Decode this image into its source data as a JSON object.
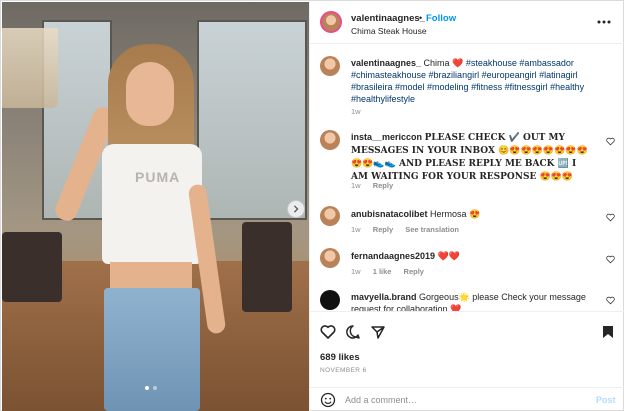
{
  "post": {
    "username": "valentinaagnes_",
    "separator": "•",
    "follow_label": "Follow",
    "location": "Chima Steak House",
    "image_shirt_text": "PUMA"
  },
  "caption": {
    "username": "valentinaagnes_",
    "text_before_emoji": "Chima",
    "emoji": "❤️",
    "hashtags": "#steakhouse #ambassador #chimasteakhouse #braziliangirl #europeangirl #latinagirl #brasileira #model #modeling #fitness #fitnessgirl #healthy #healthylifestyle",
    "time": "1w"
  },
  "comments": [
    {
      "username": "insta__mericcon",
      "text": "PLEASE CHECK ✔️ OUT MY MESSAGES IN YOUR INBOX 😊😍😍😍😍😍😍😍😍😍👟👟 AND PLEASE REPLY ME BACK 🆙 I AM WAITING FOR YOUR RESPONSE 😍😍😍",
      "time": "1w",
      "reply": "Reply"
    },
    {
      "username": "anubisnatacolibet",
      "text": "Hermosa 😍",
      "time": "1w",
      "reply": "Reply",
      "translate": "See translation"
    },
    {
      "username": "fernandaagnes2019",
      "text": "❤️❤️",
      "time": "1w",
      "likes": "1 like",
      "reply": "Reply"
    },
    {
      "username": "mavyella.brand",
      "text": "Gorgeous🌟 please Check your message request for collaboration ❤️",
      "time": "",
      "reply": ""
    }
  ],
  "likes": "689 likes",
  "date": "NOVEMBER 6",
  "add_comment": {
    "placeholder": "Add a comment…",
    "post_label": "Post"
  },
  "icons": [
    "more-icon",
    "heart-icon",
    "comment-icon",
    "share-icon",
    "bookmark-icon",
    "emoji-icon",
    "chevron-right-icon"
  ],
  "colors": {
    "accent": "#0095f6",
    "text": "#262626",
    "muted": "#8e8e8e",
    "link": "#00376b",
    "post_disabled": "#b3dbff"
  }
}
